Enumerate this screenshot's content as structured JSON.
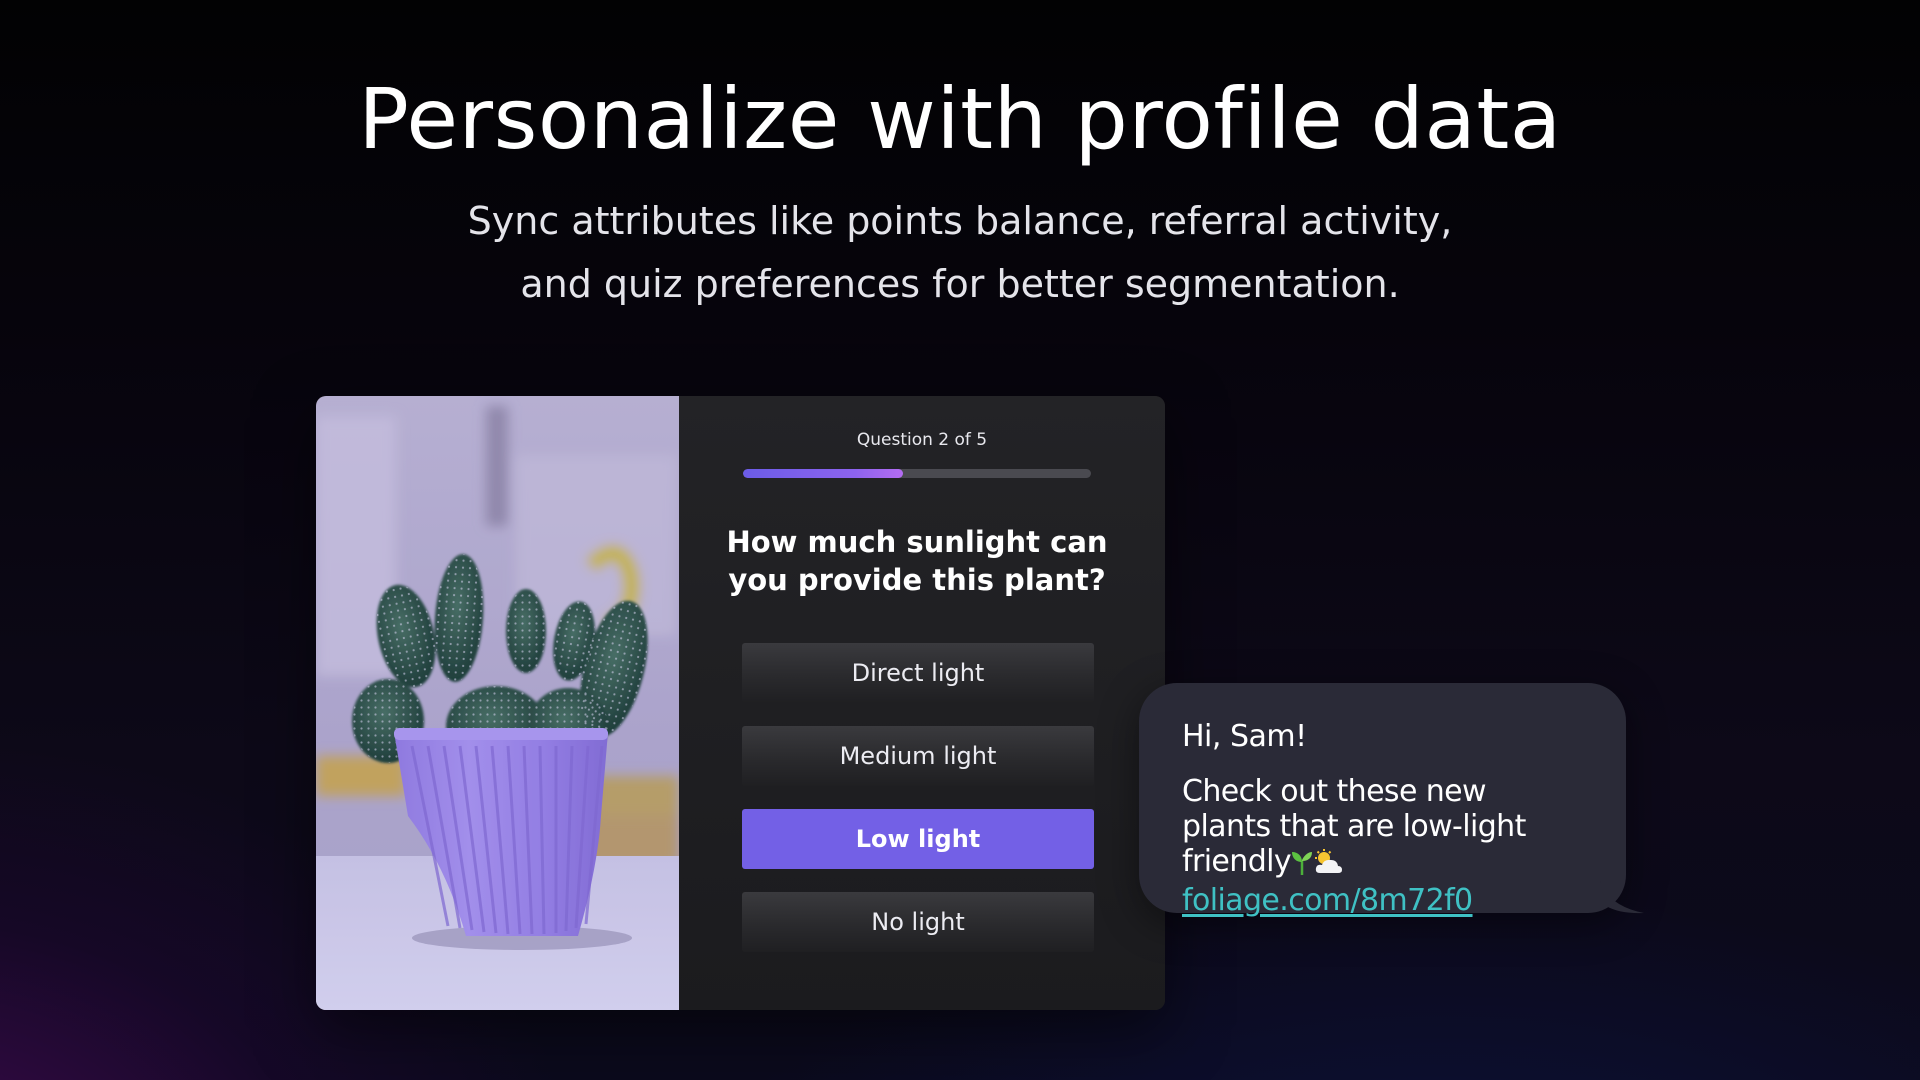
{
  "hero": {
    "title": "Personalize with profile data",
    "subtitle_line1": "Sync attributes like points balance, referral activity,",
    "subtitle_line2": "and quiz preferences for better segmentation."
  },
  "quiz": {
    "progress_label": "Question 2 of 5",
    "progress_fraction": 0.46,
    "question": "How much sunlight can you provide this plant?",
    "options": [
      {
        "label": "Direct light",
        "selected": false
      },
      {
        "label": "Medium light",
        "selected": false
      },
      {
        "label": "Low light",
        "selected": true
      },
      {
        "label": "No light",
        "selected": false
      }
    ],
    "accent_color": "#7360e6",
    "image": {
      "subject": "cactus-in-lavender-pot"
    }
  },
  "sms": {
    "greeting": "Hi, Sam!",
    "body": "Check out these new plants that are low-light friendly",
    "emoji": [
      "seedling-icon",
      "sun-behind-cloud-icon"
    ],
    "link": "foliage.com/8m72f0",
    "link_color": "#3fc1c4"
  }
}
